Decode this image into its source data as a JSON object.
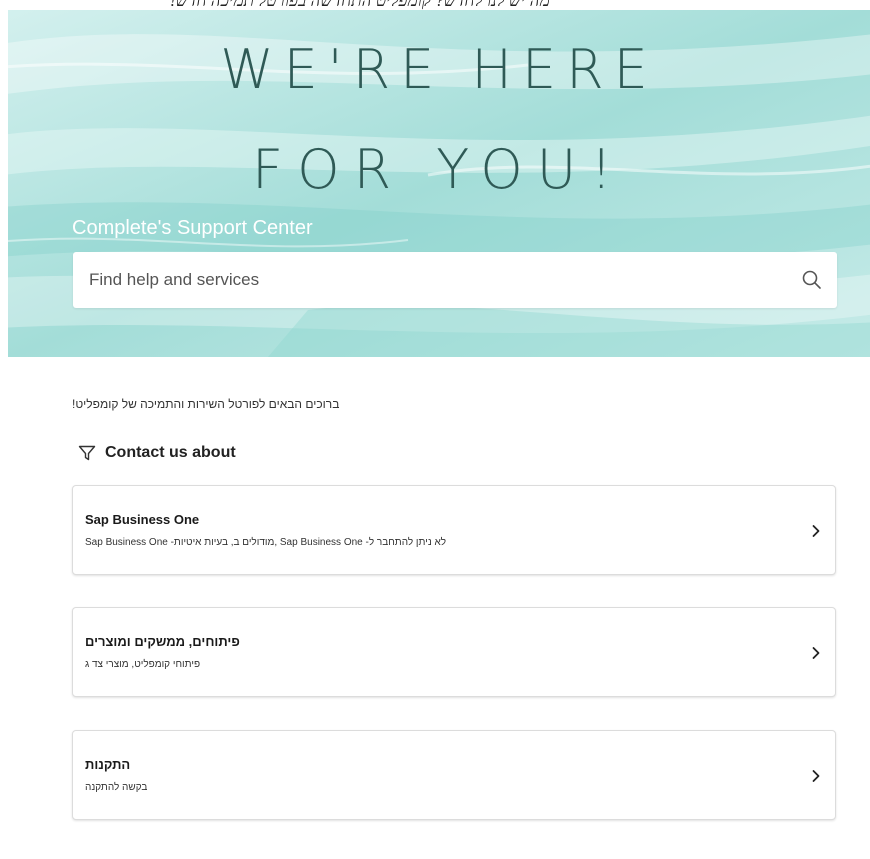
{
  "caption": "מה יש לנו לחדש? קומפליט התחדשה בפורטל תמיכה חדש!",
  "hero": {
    "headline_line1": "WE'RE HERE",
    "headline_line2": "FOR YOU!",
    "subtitle": "Complete's Support Center",
    "search_placeholder": "Find help and services"
  },
  "welcome_text": "ברוכים הבאים לפורטל השירות והתמיכה של קומפליט!",
  "contact": {
    "heading": "Contact us about",
    "cards": [
      {
        "title": "Sap Business One",
        "description": "לא ניתן להתחבר ל- Sap Business One ,מודולים ב, בעיות איטיות- Sap Business One"
      },
      {
        "title": "פיתוחים, ממשקים ומוצרים",
        "description": "פיתוחי קומפליט, מוצרי צד ג"
      },
      {
        "title": "התקנות",
        "description": "בקשה להתקנה"
      }
    ]
  },
  "icons": {
    "search": "search-icon",
    "filter": "filter-icon",
    "chevron": "chevron-right-icon"
  },
  "colors": {
    "hero_bg": "#a9e0dc",
    "headline": "#2f5a56",
    "card_border": "#dcdcdc"
  }
}
